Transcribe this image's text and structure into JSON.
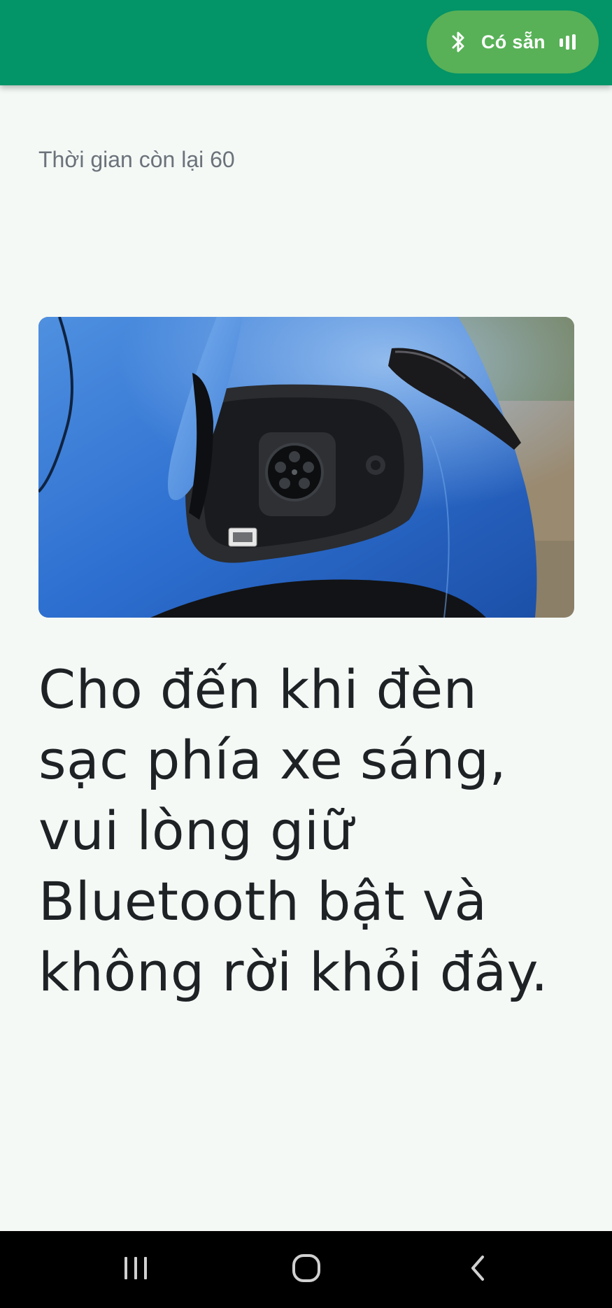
{
  "header": {
    "status_label": "Có sẵn",
    "accent_color": "#039467",
    "pill_color": "#58b157",
    "icons": [
      "bluetooth-icon",
      "signal-bars-icon"
    ]
  },
  "timer": {
    "text": "Thời gian còn lại 60"
  },
  "hero_image": {
    "subject": "blue-ev-charging-port-photo"
  },
  "instruction": {
    "line1": "Cho đến khi đèn",
    "line2": "sạc phía xe sáng,",
    "line3": "vui lòng giữ",
    "line4": "Bluetooth bật và",
    "line5": "không rời khỏi đây."
  },
  "system_nav": {
    "icons": [
      "recent-apps-icon",
      "home-icon",
      "back-icon"
    ]
  }
}
